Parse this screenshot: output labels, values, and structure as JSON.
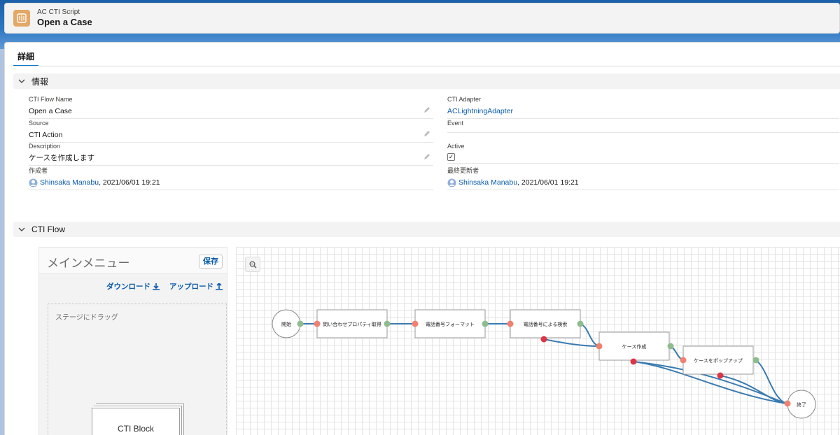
{
  "header": {
    "object_type": "AC CTI Script",
    "record_title": "Open a Case"
  },
  "tabs": [
    {
      "label": "詳細"
    }
  ],
  "sections": {
    "info": {
      "title": "情報",
      "fields": {
        "flow_name": {
          "label": "CTI Flow Name",
          "value": "Open a Case"
        },
        "source": {
          "label": "Source",
          "value": "CTI Action"
        },
        "description": {
          "label": "Description",
          "value": "ケースを作成します"
        },
        "created_by": {
          "label": "作成者",
          "user": "Shinsaka Manabu",
          "date": ", 2021/06/01 19:21"
        },
        "adapter": {
          "label": "CTI Adapter",
          "value": "ACLightningAdapter"
        },
        "event": {
          "label": "Event",
          "value": ""
        },
        "active": {
          "label": "Active",
          "checked": true,
          "mark": "✓"
        },
        "modified_by": {
          "label": "最終更新者",
          "user": "Shinsaka Manabu",
          "date": ", 2021/06/01 19:21"
        }
      }
    },
    "flow": {
      "title": "CTI Flow"
    }
  },
  "palette": {
    "title": "メインメニュー",
    "save_label": "保存",
    "download_label": "ダウンロード",
    "upload_label": "アップロード",
    "drop_label": "ステージにドラッグ",
    "block_label": "CTI Block"
  },
  "flow": {
    "nodes": [
      {
        "id": "start",
        "label": "開始"
      },
      {
        "id": "props",
        "label": "問い合わせプロパティ取得"
      },
      {
        "id": "format",
        "label": "電話番号フォーマット"
      },
      {
        "id": "search",
        "label": "電話番号による検索"
      },
      {
        "id": "create",
        "label": "ケース作成"
      },
      {
        "id": "popup",
        "label": "ケースをポップアップ"
      },
      {
        "id": "end",
        "label": "終了"
      }
    ],
    "colors": {
      "out_ok": "#8fbc8f",
      "in": "#f08070",
      "out_err": "#dc3545",
      "wire": "#3a7bb0"
    }
  }
}
